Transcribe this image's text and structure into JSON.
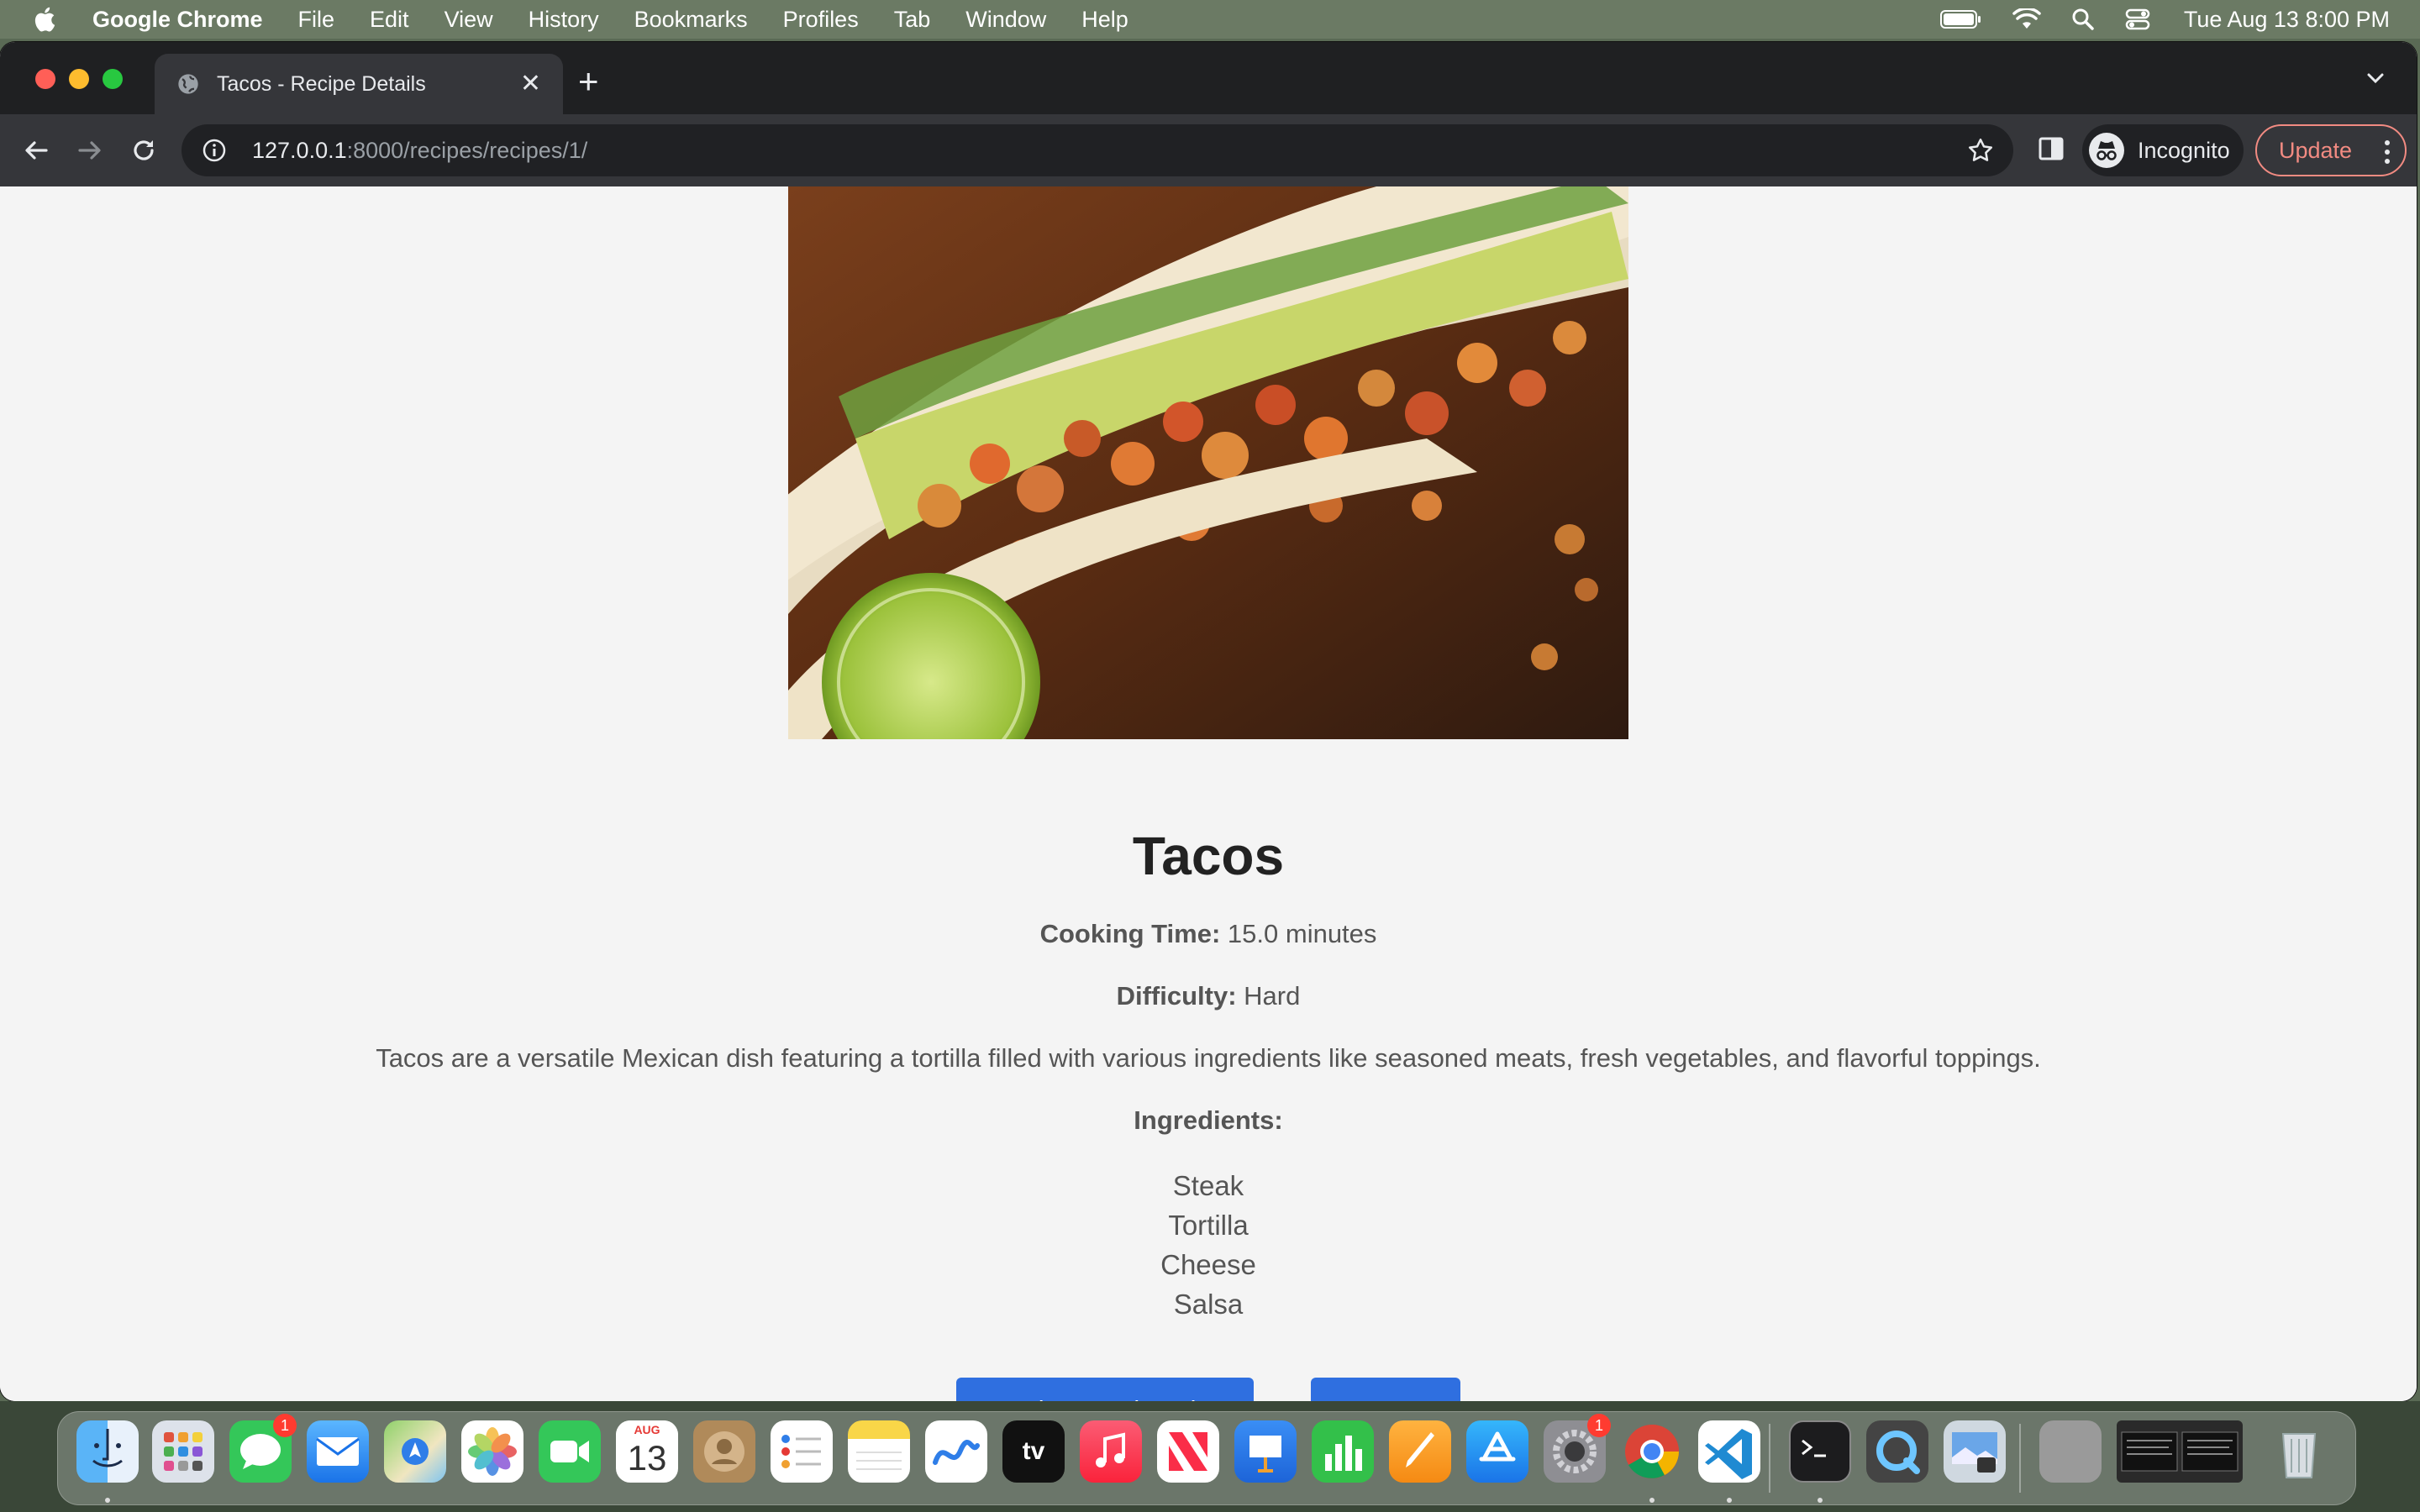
{
  "menubar": {
    "app_name": "Google Chrome",
    "items": [
      "File",
      "Edit",
      "View",
      "History",
      "Bookmarks",
      "Profiles",
      "Tab",
      "Window",
      "Help"
    ],
    "clock": "Tue Aug 13  8:00 PM"
  },
  "browser": {
    "tab_title": "Tacos - Recipe Details",
    "url_host": "127.0.0.1",
    "url_path": ":8000/recipes/recipes/1/",
    "incognito_label": "Incognito",
    "update_label": "Update"
  },
  "recipe": {
    "title": "Tacos",
    "cooking_time_label": "Cooking Time:",
    "cooking_time_value": "15.0 minutes",
    "difficulty_label": "Difficulty:",
    "difficulty_value": "Hard",
    "description": "Tacos are a versatile Mexican dish featuring a tortilla filled with various ingredients like seasoned meats, fresh vegetables, and flavorful toppings.",
    "ingredients_heading": "Ingredients:",
    "ingredients": [
      "Steak",
      "Tortilla",
      "Cheese",
      "Salsa"
    ],
    "back_button": "Back to Recipe List",
    "logout_button": "Logout"
  },
  "dock": {
    "calendar_month": "AUG",
    "calendar_day": "13",
    "messages_badge": "1",
    "settings_badge": "1",
    "tv_label": "tv",
    "apps": [
      "finder",
      "launchpad",
      "messages",
      "mail",
      "maps",
      "photos",
      "facetime",
      "calendar",
      "contacts",
      "reminders",
      "notes",
      "freeform",
      "apple-tv",
      "music",
      "news",
      "keynote",
      "numbers",
      "pages",
      "app-store",
      "system-settings",
      "chrome",
      "vscode",
      "terminal",
      "quicktime",
      "preview",
      "document",
      "window-thumbnail",
      "trash"
    ]
  },
  "colors": {
    "accent_button": "#2f6fe0",
    "update_outline": "#f28b82",
    "page_background": "#f4f4f4"
  }
}
